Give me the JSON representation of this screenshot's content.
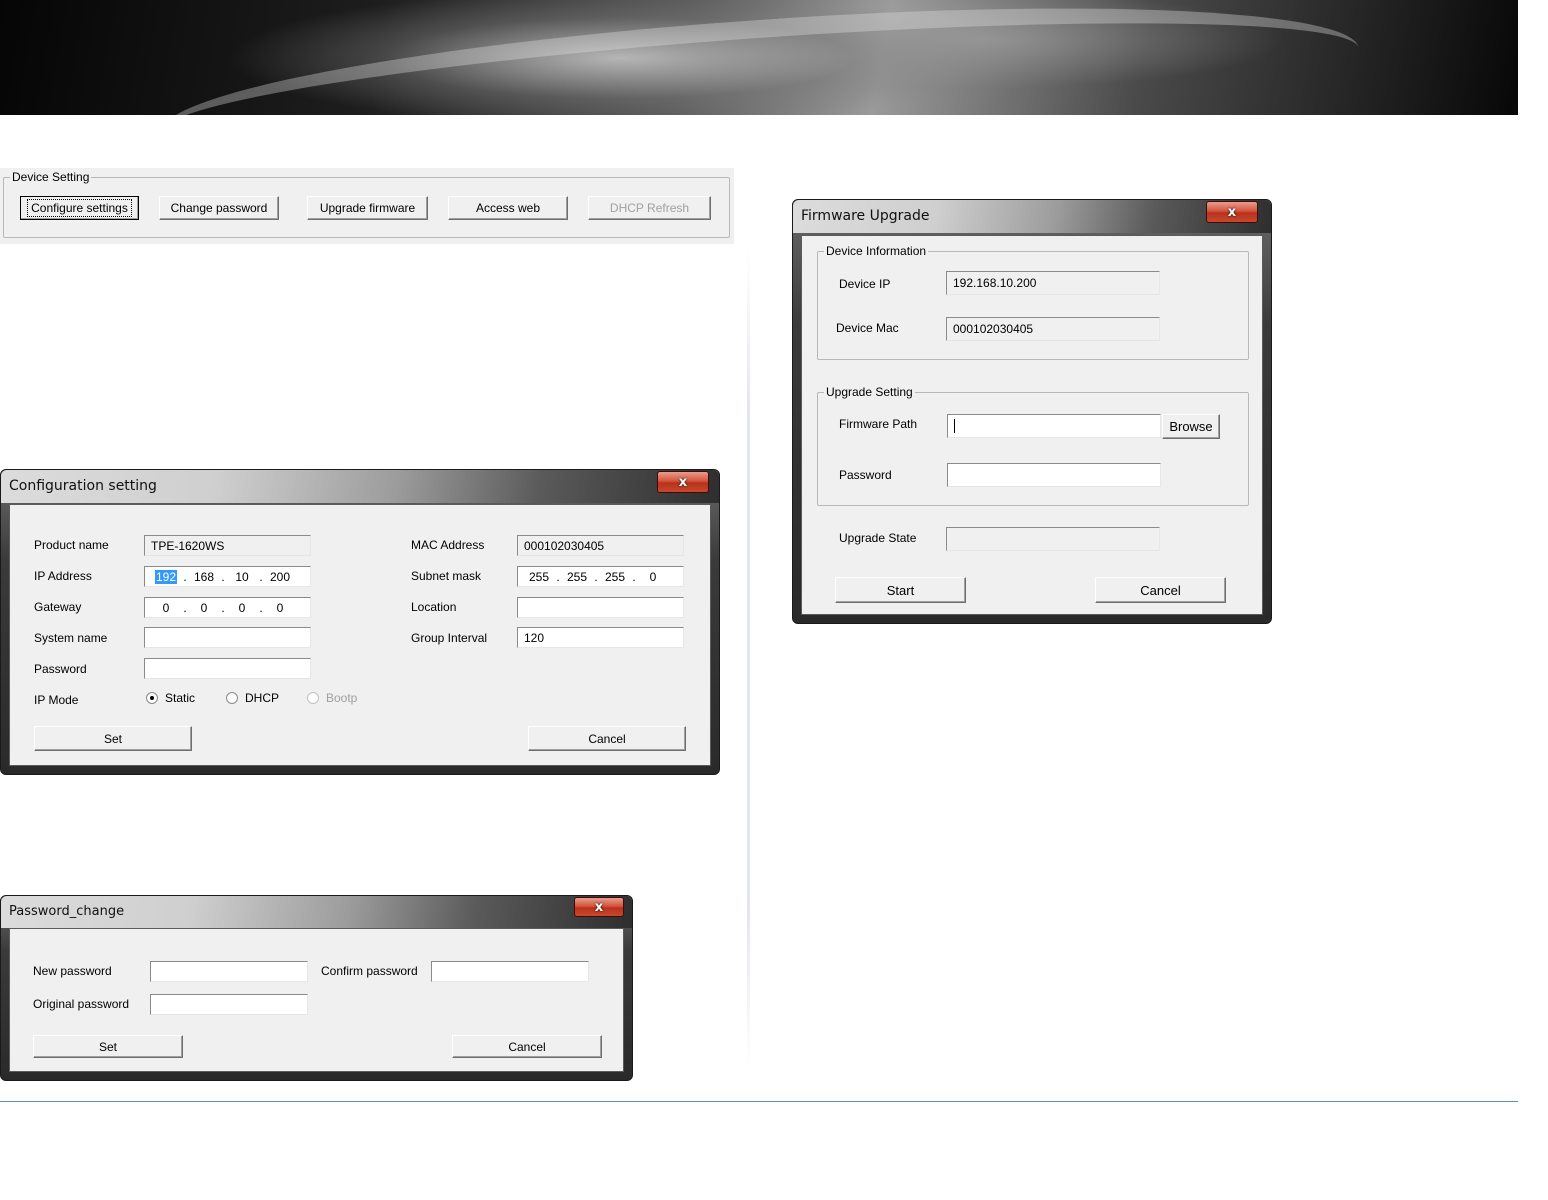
{
  "device_setting": {
    "legend": "Device Setting",
    "buttons": {
      "configure": "Configure settings",
      "change_password": "Change password",
      "upgrade_firmware": "Upgrade firmware",
      "access_web": "Access web",
      "dhcp_refresh": "DHCP Refresh"
    }
  },
  "config_window": {
    "title": "Configuration setting",
    "close": "x",
    "labels": {
      "product_name": "Product name",
      "ip_address": "IP Address",
      "gateway": "Gateway",
      "system_name": "System name",
      "password": "Password",
      "ip_mode": "IP Mode",
      "mac_address": "MAC Address",
      "subnet_mask": "Subnet mask",
      "location": "Location",
      "group_interval": "Group Interval"
    },
    "values": {
      "product_name": "TPE-1620WS",
      "ip": [
        "192",
        "168",
        "10",
        "200"
      ],
      "gateway": [
        "0",
        "0",
        "0",
        "0"
      ],
      "system_name": "",
      "password": "",
      "mac_address": "000102030405",
      "subnet": [
        "255",
        "255",
        "255",
        "0"
      ],
      "location": "",
      "group_interval": "120"
    },
    "ip_modes": {
      "static": "Static",
      "dhcp": "DHCP",
      "bootp": "Bootp",
      "selected": "Static"
    },
    "set_label": "Set",
    "cancel_label": "Cancel"
  },
  "password_window": {
    "title": "Password_change",
    "close": "x",
    "labels": {
      "new_password": "New password",
      "confirm_password": "Confirm password",
      "original_password": "Original password"
    },
    "set_label": "Set",
    "cancel_label": "Cancel"
  },
  "firmware_window": {
    "title": "Firmware Upgrade",
    "close": "x",
    "device_info": {
      "legend": "Device Information",
      "ip_label": "Device IP",
      "ip_value": "192.168.10.200",
      "mac_label": "Device Mac",
      "mac_value": "000102030405"
    },
    "upgrade_setting": {
      "legend": "Upgrade Setting",
      "path_label": "Firmware Path",
      "path_value": "",
      "browse_label": "Browse",
      "password_label": "Password"
    },
    "state_label": "Upgrade State",
    "start_label": "Start",
    "cancel_label": "Cancel"
  },
  "colors": {
    "dialog_bg": "#f0f0f0",
    "selection": "#3399ff",
    "close_button": "#c9482d",
    "rule": "#5b8fd2"
  }
}
